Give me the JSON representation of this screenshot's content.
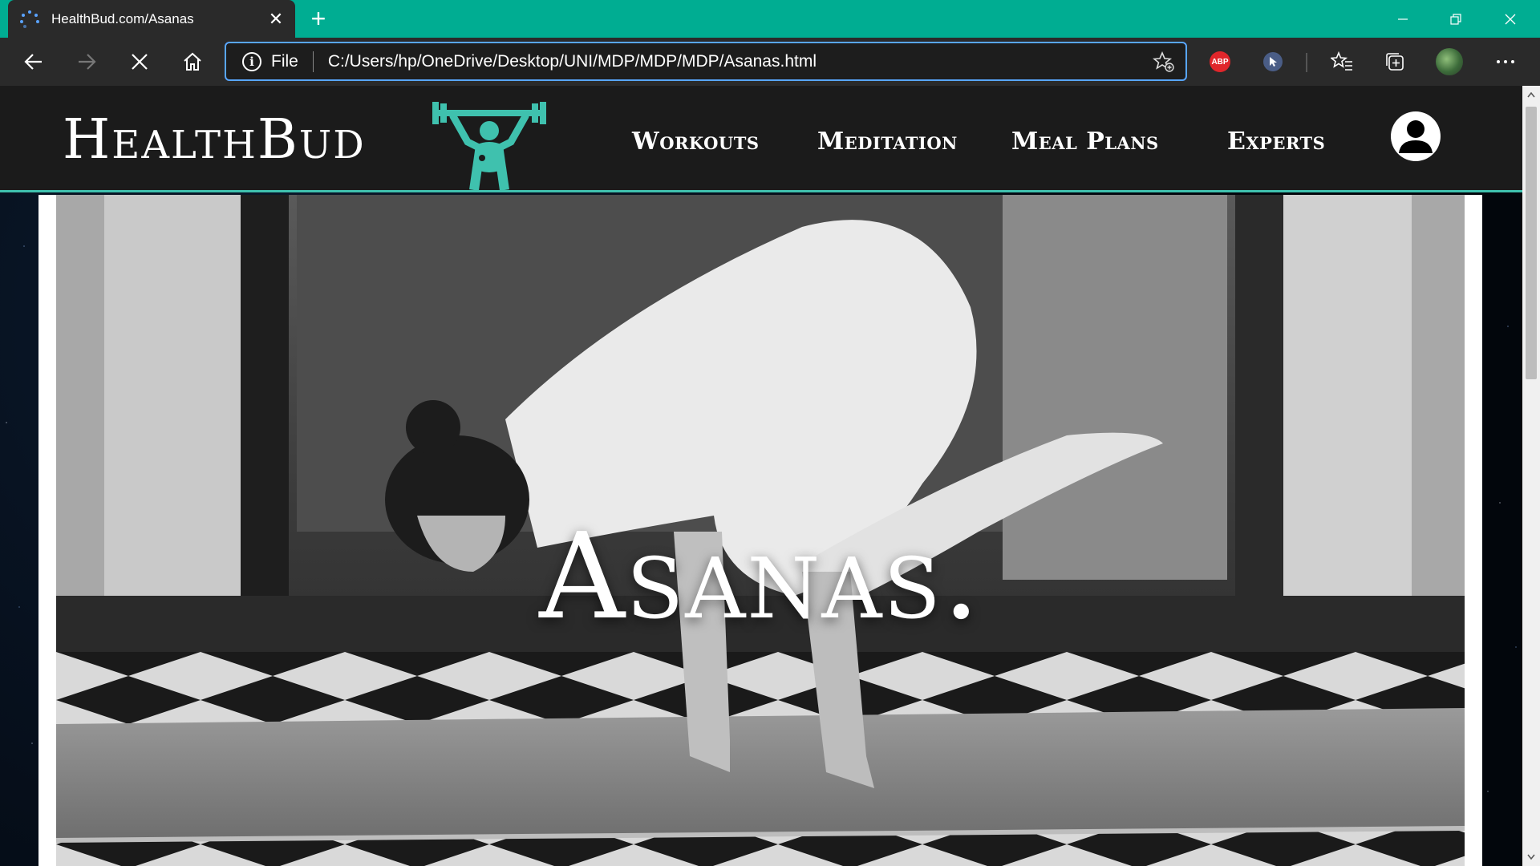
{
  "browser": {
    "tab": {
      "title": "HealthBud.com/Asanas",
      "close_glyph": "✕"
    },
    "new_tab_glyph": "+",
    "address": {
      "protocol": "File",
      "url": "C:/Users/hp/OneDrive/Desktop/UNI/MDP/MDP/MDP/Asanas.html"
    },
    "extensions": {
      "abp_label": "ABP"
    },
    "icons": [
      "back-icon",
      "forward-icon",
      "stop-icon",
      "home-icon",
      "info-icon",
      "add-favorite-icon",
      "favorites-icon",
      "collections-icon",
      "more-icon",
      "minimize-icon",
      "restore-icon",
      "close-icon"
    ],
    "colors": {
      "tabbar": "#00ad92",
      "chrome": "#2a2a2a",
      "focus": "#58a6ff"
    }
  },
  "site": {
    "brand": "HealthBud",
    "nav": [
      {
        "label": "Workouts"
      },
      {
        "label": "Meditation"
      },
      {
        "label": "Meal Plans"
      },
      {
        "label": "Experts"
      }
    ],
    "hero_title": "Asanas.",
    "colors": {
      "header_bg": "#1b1b1b",
      "accent": "#3fc1ae"
    }
  }
}
